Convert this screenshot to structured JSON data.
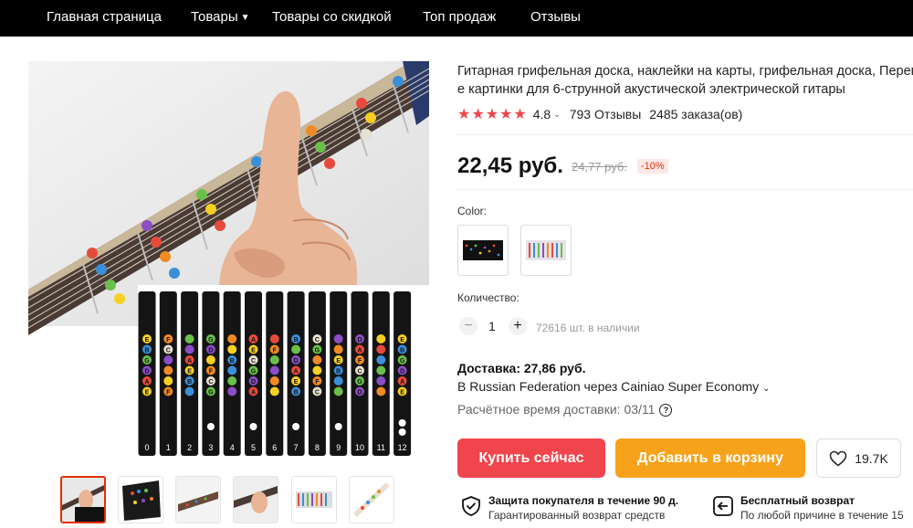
{
  "nav": {
    "items": [
      "Главная страница",
      "Товары",
      "Товары со скидкой",
      "Топ продаж",
      "Отзывы"
    ]
  },
  "product": {
    "title_line1": "Гитарная грифельная доска, наклейки на карты, грифельная доска, Перево",
    "title_line2": "е картинки для 6-струнной акустической электрической гитары",
    "rating": "4.8",
    "reviews": "793 Отзывы",
    "orders": "2485 заказа(ов)",
    "price": "22,45 руб.",
    "old_price": "24,77 руб.",
    "discount": "-10%",
    "rating_color": "#f0454c"
  },
  "fretboard": {
    "fret_numbers": [
      "0",
      "1",
      "2",
      "3",
      "4",
      "5",
      "6",
      "7",
      "8",
      "9",
      "10",
      "11",
      "12"
    ],
    "columns": [
      [
        "E",
        "B",
        "G",
        "D",
        "A",
        "E"
      ],
      [
        "F",
        "C",
        "",
        "",
        "",
        "F"
      ],
      [
        "",
        "",
        "A",
        "E",
        "B",
        ""
      ],
      [
        "G",
        "D",
        "",
        "F",
        "C",
        "G"
      ],
      [
        "",
        "",
        "B",
        "",
        "",
        ""
      ],
      [
        "A",
        "E",
        "C",
        "G",
        "D",
        "A"
      ],
      [
        "",
        "F",
        "",
        "",
        "",
        ""
      ],
      [
        "B",
        "",
        "D",
        "A",
        "E",
        "B"
      ],
      [
        "C",
        "G",
        "",
        "",
        "F",
        "C"
      ],
      [
        "",
        "",
        "E",
        "B",
        "",
        ""
      ],
      [
        "D",
        "A",
        "F",
        "C",
        "G",
        "D"
      ],
      [
        "",
        "",
        "",
        "",
        "",
        ""
      ],
      [
        "E",
        "B",
        "G",
        "D",
        "A",
        "E"
      ]
    ]
  },
  "options": {
    "color_label": "Color:",
    "quantity_label": "Количество:",
    "quantity_value": "1",
    "stock": "72616 шт. в наличии",
    "minus": "−",
    "plus": "+"
  },
  "delivery": {
    "cost": "Доставка: 27,86 руб.",
    "route": "В Russian Federation через Cainiao Super Economy",
    "time": "Расчётное время доставки: 03/11"
  },
  "actions": {
    "buy_now": "Купить сейчас",
    "add_to_cart": "Добавить в корзину",
    "wishlist_count": "19.7K",
    "buy_color": "#f0454c",
    "cart_color": "#f7a21b"
  },
  "guarantees": [
    {
      "title": "Защита покупателя в течение 90 д.",
      "subtitle": "Гарантированный возврат средств"
    },
    {
      "title": "Бесплатный возврат",
      "subtitle": "По любой причине в течение 15"
    }
  ]
}
